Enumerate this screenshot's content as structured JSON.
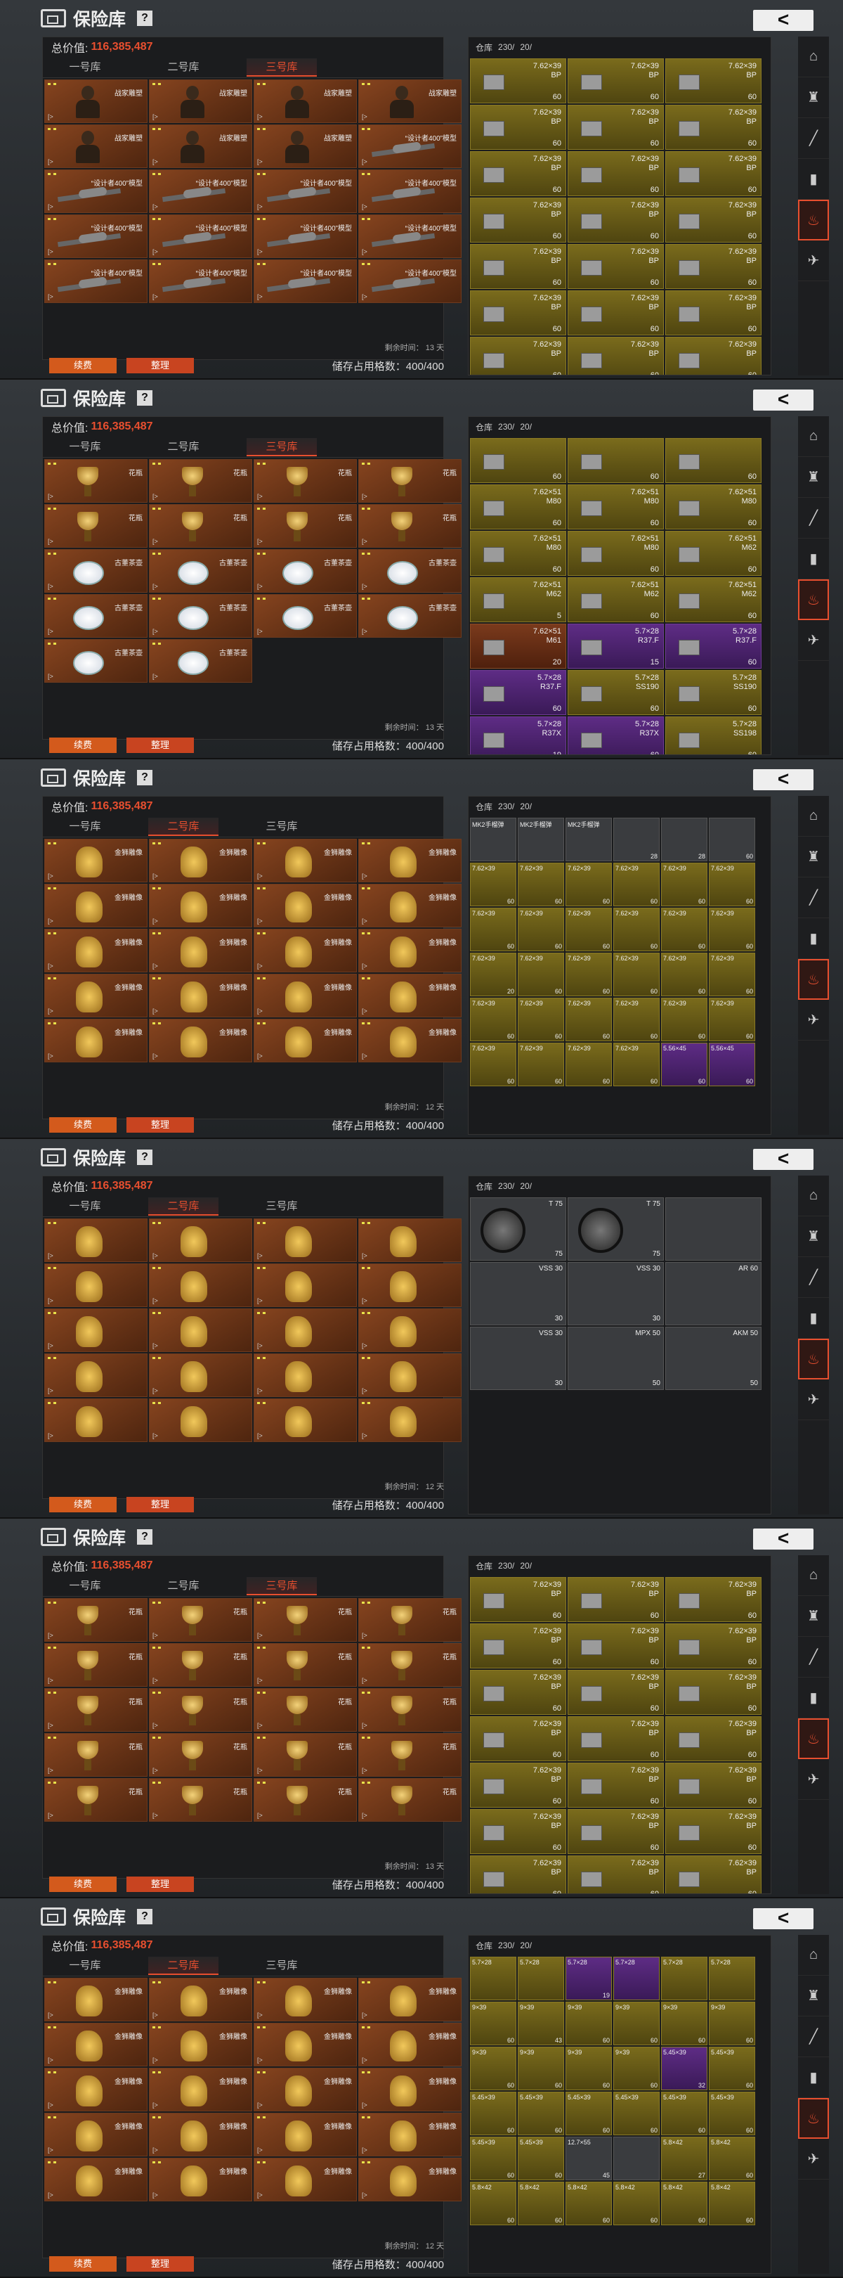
{
  "common": {
    "vault_title": "保险库",
    "help": "?",
    "back": "<",
    "value_label": "总价值:",
    "value": "116,385,487",
    "tabs": [
      "一号库",
      "二号库",
      "三号库"
    ],
    "renew": "续费",
    "sort": "整理",
    "storage": "储存占用格数：400/400",
    "warehouse": "仓库",
    "count_230": "230/",
    "count_20": "20/",
    "accent": "#e84f2f"
  },
  "panels": [
    {
      "active_tab": 2,
      "remaining": "剩余时间：  13 天",
      "item_types": [
        "bust",
        "bust",
        "bust",
        "bust",
        "bust",
        "bust",
        "bust",
        "plane",
        "plane",
        "plane",
        "plane",
        "plane",
        "plane",
        "plane",
        "plane",
        "plane",
        "plane",
        "plane",
        "plane",
        "plane"
      ],
      "item_names": [
        "战家雕塑",
        "战家雕塑",
        "战家雕塑",
        "战家雕塑",
        "战家雕塑",
        "战家雕塑",
        "战家雕塑",
        "“设计者400”模型",
        "“设计者400”模型",
        "“设计者400”模型",
        "“设计者400”模型",
        "“设计者400”模型",
        "“设计者400”模型",
        "“设计者400”模型",
        "“设计者400”模型",
        "“设计者400”模型",
        "“设计者400”模型",
        "“设计者400”模型",
        "“设计者400”模型",
        "“设计者400”模型"
      ],
      "right": "ammo"
    },
    {
      "active_tab": 2,
      "remaining": "剩余时间：  13 天",
      "item_types": [
        "trophy",
        "trophy",
        "trophy",
        "trophy",
        "trophy",
        "trophy",
        "trophy",
        "trophy",
        "teapot",
        "teapot",
        "teapot",
        "teapot",
        "teapot",
        "teapot",
        "teapot",
        "teapot",
        "teapot",
        "teapot"
      ],
      "item_names": [
        "花瓶",
        "花瓶",
        "花瓶",
        "花瓶",
        "花瓶",
        "花瓶",
        "花瓶",
        "花瓶",
        "古董茶壶",
        "古董茶壶",
        "古董茶壶",
        "古董茶壶",
        "古董茶壶",
        "古董茶壶",
        "古董茶壶",
        "古董茶壶",
        "古董茶壶",
        "古董茶壶"
      ],
      "right": "ammo2"
    },
    {
      "active_tab": 1,
      "remaining": "剩余时间：  12 天",
      "item_types": [
        "lion",
        "lion",
        "lion",
        "lion",
        "lion",
        "lion",
        "lion",
        "lion",
        "lion",
        "lion",
        "lion",
        "lion",
        "lion",
        "lion",
        "lion",
        "lion",
        "lion",
        "lion",
        "lion",
        "lion"
      ],
      "item_names": [
        "金狮雕像",
        "金狮雕像",
        "金狮雕像",
        "金狮雕像",
        "金狮雕像",
        "金狮雕像",
        "金狮雕像",
        "金狮雕像",
        "金狮雕像",
        "金狮雕像",
        "金狮雕像",
        "金狮雕像",
        "金狮雕像",
        "金狮雕像",
        "金狮雕像",
        "金狮雕像",
        "金狮雕像",
        "金狮雕像",
        "金狮雕像",
        "金狮雕像"
      ],
      "right": "small"
    },
    {
      "active_tab": 1,
      "remaining": "剩余时间：  12 天",
      "item_types": [
        "lion",
        "lion",
        "lion",
        "lion",
        "lion",
        "lion",
        "lion",
        "lion",
        "lion",
        "lion",
        "lion",
        "lion",
        "lion",
        "lion",
        "lion",
        "lion",
        "lion",
        "lion",
        "lion",
        "lion"
      ],
      "item_names": [
        "",
        "",
        "",
        "",
        "",
        "",
        "",
        "",
        "",
        "",
        "",
        "",
        "",
        "",
        "",
        "",
        "",
        "",
        "",
        ""
      ],
      "right": "mags"
    },
    {
      "active_tab": 2,
      "remaining": "剩余时间：  13 天",
      "item_types": [
        "trophy",
        "trophy",
        "trophy",
        "trophy",
        "trophy",
        "trophy",
        "trophy",
        "trophy",
        "trophy",
        "trophy",
        "trophy",
        "trophy",
        "trophy",
        "trophy",
        "trophy",
        "trophy",
        "trophy",
        "trophy",
        "trophy",
        "trophy"
      ],
      "item_names": [
        "花瓶",
        "花瓶",
        "花瓶",
        "花瓶",
        "花瓶",
        "花瓶",
        "花瓶",
        "花瓶",
        "花瓶",
        "花瓶",
        "花瓶",
        "花瓶",
        "花瓶",
        "花瓶",
        "花瓶",
        "花瓶",
        "花瓶",
        "花瓶",
        "花瓶",
        "花瓶"
      ],
      "right": "ammo"
    },
    {
      "active_tab": 1,
      "remaining": "剩余时间：  12 天",
      "item_types": [
        "lion",
        "lion",
        "lion",
        "lion",
        "lion",
        "lion",
        "lion",
        "lion",
        "lion",
        "lion",
        "lion",
        "lion",
        "lion",
        "lion",
        "lion",
        "lion",
        "lion",
        "lion",
        "lion",
        "lion"
      ],
      "item_names": [
        "金狮雕像",
        "金狮雕像",
        "金狮雕像",
        "金狮雕像",
        "金狮雕像",
        "金狮雕像",
        "金狮雕像",
        "金狮雕像",
        "金狮雕像",
        "金狮雕像",
        "金狮雕像",
        "金狮雕像",
        "金狮雕像",
        "金狮雕像",
        "金狮雕像",
        "金狮雕像",
        "金狮雕像",
        "金狮雕像",
        "金狮雕像",
        "金狮雕像"
      ],
      "right": "small2"
    }
  ],
  "ammo_sets": {
    "ammo": [
      {
        "cal": "7.62×39\nBP",
        "cnt": "60",
        "c": "y"
      },
      {
        "cal": "7.62×39\nBP",
        "cnt": "60",
        "c": "y"
      },
      {
        "cal": "7.62×39\nBP",
        "cnt": "60",
        "c": "y"
      },
      {
        "cal": "7.62×39\nBP",
        "cnt": "60",
        "c": "y"
      },
      {
        "cal": "7.62×39\nBP",
        "cnt": "60",
        "c": "y"
      },
      {
        "cal": "7.62×39\nBP",
        "cnt": "60",
        "c": "y"
      },
      {
        "cal": "7.62×39\nBP",
        "cnt": "60",
        "c": "y"
      },
      {
        "cal": "7.62×39\nBP",
        "cnt": "60",
        "c": "y"
      },
      {
        "cal": "7.62×39\nBP",
        "cnt": "60",
        "c": "y"
      },
      {
        "cal": "7.62×39\nBP",
        "cnt": "60",
        "c": "y"
      },
      {
        "cal": "7.62×39\nBP",
        "cnt": "60",
        "c": "y"
      },
      {
        "cal": "7.62×39\nBP",
        "cnt": "60",
        "c": "y"
      },
      {
        "cal": "7.62×39\nBP",
        "cnt": "60",
        "c": "y"
      },
      {
        "cal": "7.62×39\nBP",
        "cnt": "60",
        "c": "y"
      },
      {
        "cal": "7.62×39\nBP",
        "cnt": "60",
        "c": "y"
      },
      {
        "cal": "7.62×39\nBP",
        "cnt": "60",
        "c": "y"
      },
      {
        "cal": "7.62×39\nBP",
        "cnt": "60",
        "c": "y"
      },
      {
        "cal": "7.62×39\nBP",
        "cnt": "60",
        "c": "y"
      },
      {
        "cal": "7.62×39\nBP",
        "cnt": "60",
        "c": "y"
      },
      {
        "cal": "7.62×39\nBP",
        "cnt": "60",
        "c": "y"
      },
      {
        "cal": "7.62×39\nBP",
        "cnt": "60",
        "c": "y"
      }
    ],
    "ammo2": [
      {
        "cal": "",
        "cnt": "60",
        "c": "y"
      },
      {
        "cal": "",
        "cnt": "60",
        "c": "y"
      },
      {
        "cal": "",
        "cnt": "60",
        "c": "y"
      },
      {
        "cal": "7.62×51\nM80",
        "cnt": "60",
        "c": "y"
      },
      {
        "cal": "7.62×51\nM80",
        "cnt": "60",
        "c": "y"
      },
      {
        "cal": "7.62×51\nM80",
        "cnt": "60",
        "c": "y"
      },
      {
        "cal": "7.62×51\nM80",
        "cnt": "60",
        "c": "y"
      },
      {
        "cal": "7.62×51\nM80",
        "cnt": "60",
        "c": "y"
      },
      {
        "cal": "7.62×51\nM62",
        "cnt": "60",
        "c": "y"
      },
      {
        "cal": "7.62×51\nM62",
        "cnt": "5",
        "c": "y"
      },
      {
        "cal": "7.62×51\nM62",
        "cnt": "60",
        "c": "y"
      },
      {
        "cal": "7.62×51\nM62",
        "cnt": "60",
        "c": "y"
      },
      {
        "cal": "7.62×51\nM61",
        "cnt": "20",
        "c": "r"
      },
      {
        "cal": "5.7×28\nR37.F",
        "cnt": "15",
        "c": "p"
      },
      {
        "cal": "5.7×28\nR37.F",
        "cnt": "60",
        "c": "p"
      },
      {
        "cal": "5.7×28\nR37.F",
        "cnt": "60",
        "c": "p"
      },
      {
        "cal": "5.7×28\nSS190",
        "cnt": "60",
        "c": "y"
      },
      {
        "cal": "5.7×28\nSS190",
        "cnt": "60",
        "c": "y"
      },
      {
        "cal": "5.7×28\nR37X",
        "cnt": "19",
        "c": "p"
      },
      {
        "cal": "5.7×28\nR37X",
        "cnt": "60",
        "c": "p"
      },
      {
        "cal": "5.7×28\nSS198",
        "cnt": "60",
        "c": "y"
      }
    ]
  },
  "small_grid": [
    {
      "cal": "MK2手榴弹",
      "cnt": "",
      "c": "g"
    },
    {
      "cal": "MK2手榴弹",
      "cnt": "",
      "c": "g"
    },
    {
      "cal": "MK2手榴弹",
      "cnt": "",
      "c": "g"
    },
    {
      "cal": "",
      "cnt": "28",
      "c": "g"
    },
    {
      "cal": "",
      "cnt": "28",
      "c": "g"
    },
    {
      "cal": "",
      "cnt": "60",
      "c": "g"
    },
    {
      "cal": "7.62×39",
      "cnt": "60",
      "c": "y"
    },
    {
      "cal": "7.62×39",
      "cnt": "60",
      "c": "y"
    },
    {
      "cal": "7.62×39",
      "cnt": "60",
      "c": "y"
    },
    {
      "cal": "7.62×39",
      "cnt": "60",
      "c": "y"
    },
    {
      "cal": "7.62×39",
      "cnt": "60",
      "c": "y"
    },
    {
      "cal": "7.62×39",
      "cnt": "60",
      "c": "y"
    },
    {
      "cal": "7.62×39",
      "cnt": "60",
      "c": "y"
    },
    {
      "cal": "7.62×39",
      "cnt": "60",
      "c": "y"
    },
    {
      "cal": "7.62×39",
      "cnt": "60",
      "c": "y"
    },
    {
      "cal": "7.62×39",
      "cnt": "60",
      "c": "y"
    },
    {
      "cal": "7.62×39",
      "cnt": "60",
      "c": "y"
    },
    {
      "cal": "7.62×39",
      "cnt": "60",
      "c": "y"
    },
    {
      "cal": "7.62×39",
      "cnt": "20",
      "c": "y"
    },
    {
      "cal": "7.62×39",
      "cnt": "60",
      "c": "y"
    },
    {
      "cal": "7.62×39",
      "cnt": "60",
      "c": "y"
    },
    {
      "cal": "7.62×39",
      "cnt": "60",
      "c": "y"
    },
    {
      "cal": "7.62×39",
      "cnt": "60",
      "c": "y"
    },
    {
      "cal": "7.62×39",
      "cnt": "60",
      "c": "y"
    },
    {
      "cal": "7.62×39",
      "cnt": "60",
      "c": "y"
    },
    {
      "cal": "7.62×39",
      "cnt": "60",
      "c": "y"
    },
    {
      "cal": "7.62×39",
      "cnt": "60",
      "c": "y"
    },
    {
      "cal": "7.62×39",
      "cnt": "60",
      "c": "y"
    },
    {
      "cal": "7.62×39",
      "cnt": "60",
      "c": "y"
    },
    {
      "cal": "7.62×39",
      "cnt": "60",
      "c": "y"
    },
    {
      "cal": "7.62×39",
      "cnt": "60",
      "c": "y"
    },
    {
      "cal": "7.62×39",
      "cnt": "60",
      "c": "y"
    },
    {
      "cal": "7.62×39",
      "cnt": "60",
      "c": "y"
    },
    {
      "cal": "7.62×39",
      "cnt": "60",
      "c": "y"
    },
    {
      "cal": "5.56×45",
      "cnt": "60",
      "c": "p"
    },
    {
      "cal": "5.56×45",
      "cnt": "60",
      "c": "p"
    }
  ],
  "small_grid2": [
    {
      "cal": "5.7×28",
      "cnt": "",
      "c": "y"
    },
    {
      "cal": "5.7×28",
      "cnt": "",
      "c": "y"
    },
    {
      "cal": "5.7×28",
      "cnt": "19",
      "c": "p"
    },
    {
      "cal": "5.7×28",
      "cnt": "",
      "c": "p"
    },
    {
      "cal": "5.7×28",
      "cnt": "",
      "c": "y"
    },
    {
      "cal": "5.7×28",
      "cnt": "",
      "c": "y"
    },
    {
      "cal": "9×39",
      "cnt": "60",
      "c": "y"
    },
    {
      "cal": "9×39",
      "cnt": "43",
      "c": "y"
    },
    {
      "cal": "9×39",
      "cnt": "60",
      "c": "y"
    },
    {
      "cal": "9×39",
      "cnt": "60",
      "c": "y"
    },
    {
      "cal": "9×39",
      "cnt": "60",
      "c": "y"
    },
    {
      "cal": "9×39",
      "cnt": "60",
      "c": "y"
    },
    {
      "cal": "9×39",
      "cnt": "60",
      "c": "y"
    },
    {
      "cal": "9×39",
      "cnt": "60",
      "c": "y"
    },
    {
      "cal": "9×39",
      "cnt": "60",
      "c": "y"
    },
    {
      "cal": "9×39",
      "cnt": "60",
      "c": "y"
    },
    {
      "cal": "5.45×39",
      "cnt": "32",
      "c": "p"
    },
    {
      "cal": "5.45×39",
      "cnt": "60",
      "c": "y"
    },
    {
      "cal": "5.45×39",
      "cnt": "60",
      "c": "y"
    },
    {
      "cal": "5.45×39",
      "cnt": "60",
      "c": "y"
    },
    {
      "cal": "5.45×39",
      "cnt": "60",
      "c": "y"
    },
    {
      "cal": "5.45×39",
      "cnt": "60",
      "c": "y"
    },
    {
      "cal": "5.45×39",
      "cnt": "60",
      "c": "y"
    },
    {
      "cal": "5.45×39",
      "cnt": "60",
      "c": "y"
    },
    {
      "cal": "5.45×39",
      "cnt": "60",
      "c": "y"
    },
    {
      "cal": "5.45×39",
      "cnt": "60",
      "c": "y"
    },
    {
      "cal": "12.7×55",
      "cnt": "45",
      "c": "g"
    },
    {
      "cal": "",
      "cnt": "",
      "c": "g"
    },
    {
      "cal": "5.8×42",
      "cnt": "27",
      "c": "y"
    },
    {
      "cal": "5.8×42",
      "cnt": "60",
      "c": "y"
    },
    {
      "cal": "5.8×42",
      "cnt": "60",
      "c": "y"
    },
    {
      "cal": "5.8×42",
      "cnt": "60",
      "c": "y"
    },
    {
      "cal": "5.8×42",
      "cnt": "60",
      "c": "y"
    },
    {
      "cal": "5.8×42",
      "cnt": "60",
      "c": "y"
    },
    {
      "cal": "5.8×42",
      "cnt": "60",
      "c": "y"
    },
    {
      "cal": "5.8×42",
      "cnt": "60",
      "c": "y"
    }
  ],
  "mags": [
    {
      "cal": "T 75",
      "cnt": "75"
    },
    {
      "cal": "T 75",
      "cnt": "75"
    },
    {
      "cal": "",
      "cnt": ""
    },
    {
      "cal": "VSS 30",
      "cnt": "30"
    },
    {
      "cal": "VSS 30",
      "cnt": "30"
    },
    {
      "cal": "AR 60",
      "cnt": ""
    },
    {
      "cal": "VSS 30",
      "cnt": "30"
    },
    {
      "cal": "MPX 50",
      "cnt": "50"
    },
    {
      "cal": "AKM 50",
      "cnt": "50"
    }
  ],
  "side_icons": [
    "home-icon",
    "armor-icon",
    "rifle-icon",
    "magazine-icon",
    "fire-icon",
    "bird-icon"
  ]
}
